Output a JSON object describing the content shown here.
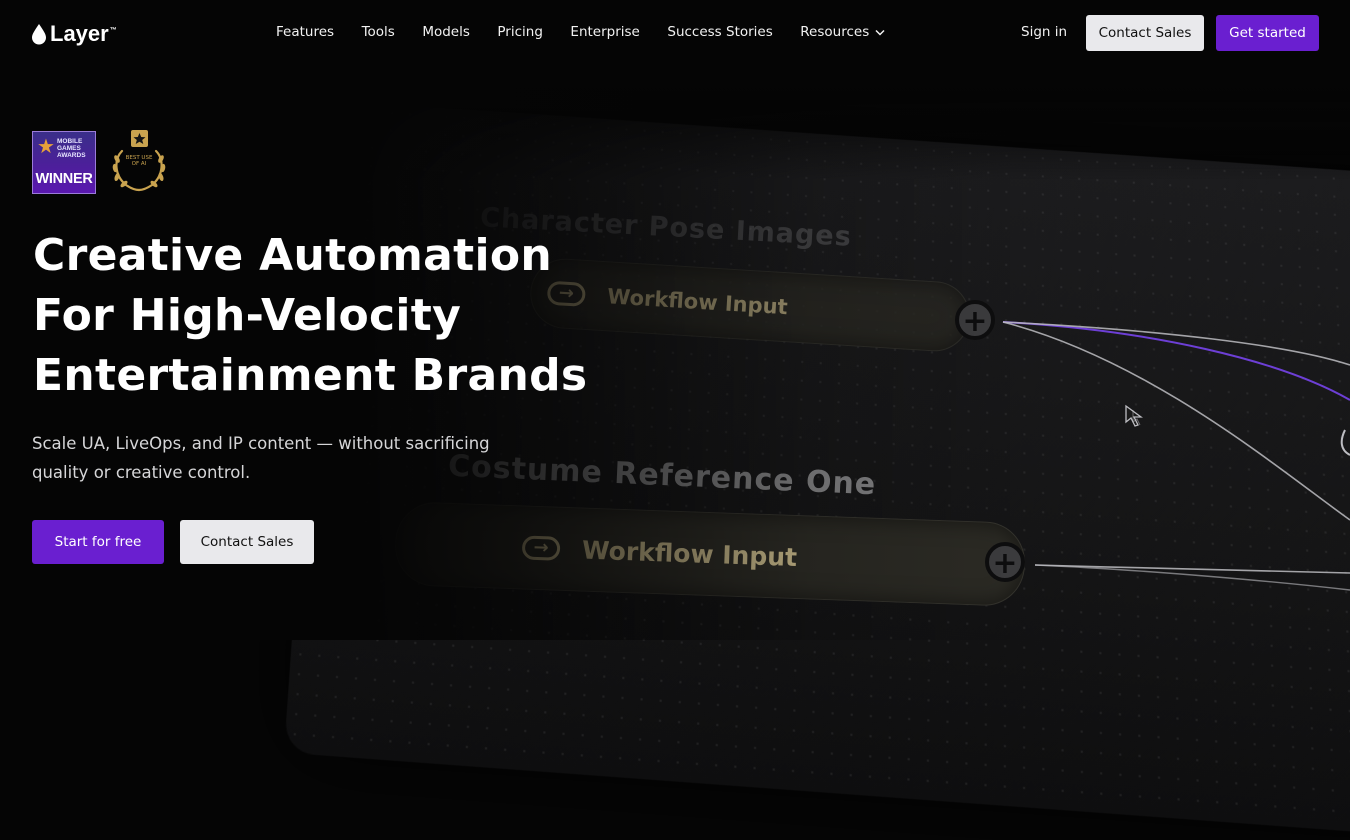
{
  "brand": {
    "name": "Layer",
    "trademark": "™"
  },
  "nav": {
    "items": [
      {
        "label": "Features"
      },
      {
        "label": "Tools"
      },
      {
        "label": "Models"
      },
      {
        "label": "Pricing"
      },
      {
        "label": "Enterprise"
      },
      {
        "label": "Success Stories"
      },
      {
        "label": "Resources",
        "has_dropdown": true
      }
    ],
    "sign_in": "Sign in",
    "contact_sales": "Contact Sales",
    "get_started": "Get started"
  },
  "awards": {
    "winner_badge": {
      "small_text": "MOBILE GAMES AWARDS",
      "main_text": "WINNER"
    },
    "laurel_badge": {
      "text": "BEST USE OF AI"
    }
  },
  "hero": {
    "headline_lines": [
      "Creative Automation",
      "For High-Velocity",
      "Entertainment Brands"
    ],
    "subtext": "Scale UA, LiveOps, and IP content — without sacrificing quality or creative control.",
    "primary_cta": "Start for free",
    "secondary_cta": "Contact Sales"
  },
  "background_canvas": {
    "node_1_title": "Character Pose Images",
    "node_1_pill": "Workflow Input",
    "node_2_title": "Costume Reference One",
    "node_2_pill": "Workflow Input"
  },
  "colors": {
    "accent": "#6a1fd0",
    "background": "#050505",
    "button_light": "#e9e9ec",
    "node_text": "#c8b98a"
  }
}
